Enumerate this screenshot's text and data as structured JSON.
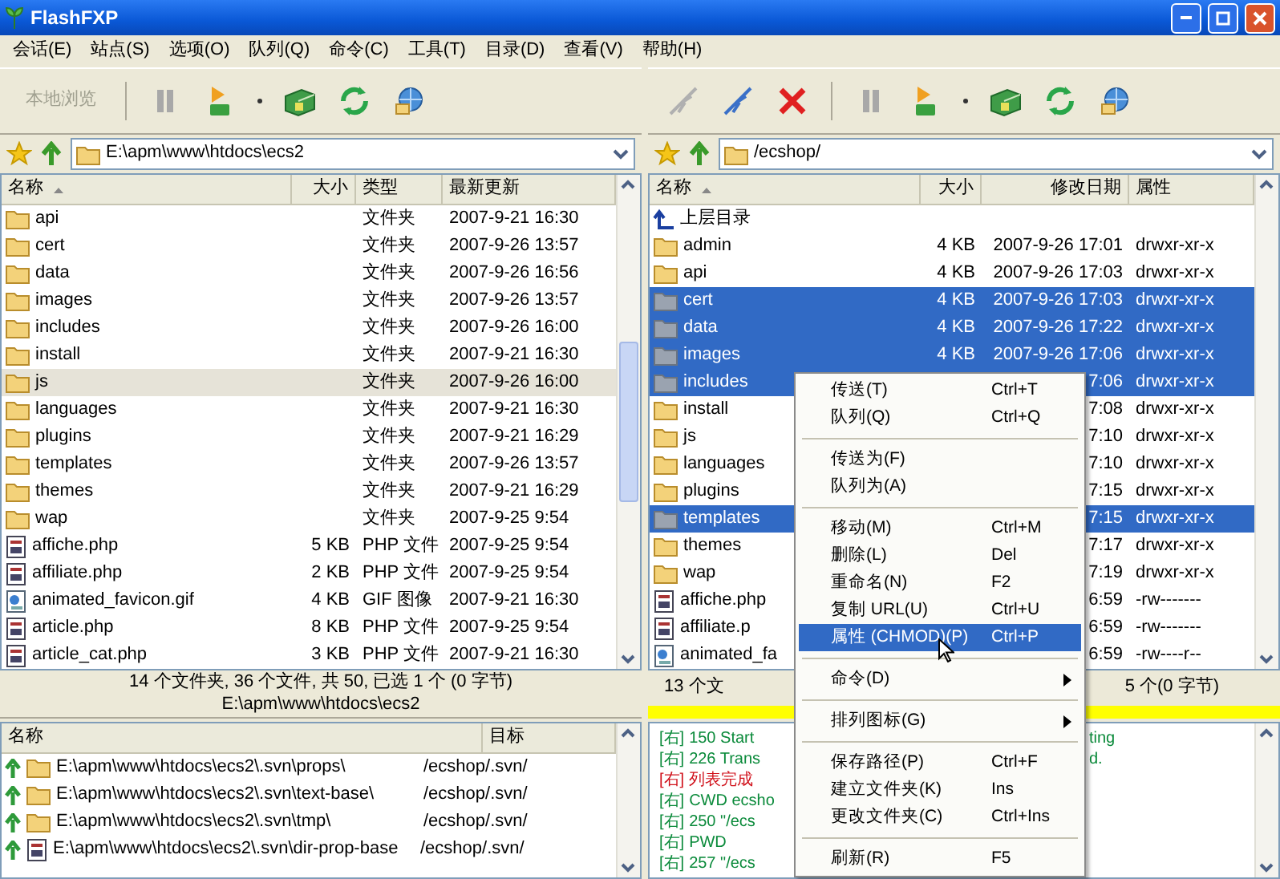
{
  "window": {
    "title": "FlashFXP"
  },
  "menu": [
    "会话(E)",
    "站点(S)",
    "选项(O)",
    "队列(Q)",
    "命令(C)",
    "工具(T)",
    "目录(D)",
    "查看(V)",
    "帮助(H)"
  ],
  "left_pane": {
    "toolbar_button": {
      "label": "本地浏览",
      "disabled": true
    },
    "path": "E:\\apm\\www\\htdocs\\ecs2",
    "columns": [
      "名称",
      "大小",
      "类型",
      "最新更新"
    ],
    "rows": [
      {
        "kind": "folder",
        "name": "api",
        "type": "文件夹",
        "date": "2007-9-21 16:30",
        "selected": false
      },
      {
        "kind": "folder",
        "name": "cert",
        "type": "文件夹",
        "date": "2007-9-26 13:57",
        "selected": false
      },
      {
        "kind": "folder",
        "name": "data",
        "type": "文件夹",
        "date": "2007-9-26 16:56",
        "selected": false
      },
      {
        "kind": "folder",
        "name": "images",
        "type": "文件夹",
        "date": "2007-9-26 13:57",
        "selected": false
      },
      {
        "kind": "folder",
        "name": "includes",
        "type": "文件夹",
        "date": "2007-9-26 16:00",
        "selected": false
      },
      {
        "kind": "folder",
        "name": "install",
        "type": "文件夹",
        "date": "2007-9-21 16:30",
        "selected": false
      },
      {
        "kind": "folder",
        "name": "js",
        "type": "文件夹",
        "date": "2007-9-26 16:00",
        "selected": true
      },
      {
        "kind": "folder",
        "name": "languages",
        "type": "文件夹",
        "date": "2007-9-21 16:30",
        "selected": false
      },
      {
        "kind": "folder",
        "name": "plugins",
        "type": "文件夹",
        "date": "2007-9-21 16:29",
        "selected": false
      },
      {
        "kind": "folder",
        "name": "templates",
        "type": "文件夹",
        "date": "2007-9-26 13:57",
        "selected": false
      },
      {
        "kind": "folder",
        "name": "themes",
        "type": "文件夹",
        "date": "2007-9-21 16:29",
        "selected": false
      },
      {
        "kind": "folder",
        "name": "wap",
        "type": "文件夹",
        "date": "2007-9-25 9:54",
        "selected": false
      },
      {
        "kind": "php",
        "name": "affiche.php",
        "size": "5 KB",
        "type": "PHP 文件",
        "date": "2007-9-25 9:54",
        "selected": false
      },
      {
        "kind": "php",
        "name": "affiliate.php",
        "size": "2 KB",
        "type": "PHP 文件",
        "date": "2007-9-25 9:54",
        "selected": false
      },
      {
        "kind": "gif",
        "name": "animated_favicon.gif",
        "size": "4 KB",
        "type": "GIF 图像",
        "date": "2007-9-21 16:30",
        "selected": false
      },
      {
        "kind": "php",
        "name": "article.php",
        "size": "8 KB",
        "type": "PHP 文件",
        "date": "2007-9-25 9:54",
        "selected": false
      },
      {
        "kind": "php",
        "name": "article_cat.php",
        "size": "3 KB",
        "type": "PHP 文件",
        "date": "2007-9-21 16:30",
        "selected": false
      }
    ],
    "status": [
      "14 个文件夹, 36 个文件, 共 50, 已选 1 个 (0 字节)",
      "E:\\apm\\www\\htdocs\\ecs2"
    ]
  },
  "right_pane": {
    "path": "/ecshop/",
    "columns": [
      "名称",
      "大小",
      "修改日期",
      "属性"
    ],
    "rows": [
      {
        "kind": "parent",
        "name": "上层目录",
        "selected": false
      },
      {
        "kind": "folder",
        "name": "admin",
        "size": "4 KB",
        "date": "2007-9-26 17:01",
        "attributes": "drwxr-xr-x",
        "selected": false
      },
      {
        "kind": "folder",
        "name": "api",
        "size": "4 KB",
        "date": "2007-9-26 17:03",
        "attributes": "drwxr-xr-x",
        "selected": false
      },
      {
        "kind": "folder",
        "name": "cert",
        "size": "4 KB",
        "date": "2007-9-26 17:03",
        "attributes": "drwxr-xr-x",
        "selected": true
      },
      {
        "kind": "folder",
        "name": "data",
        "size": "4 KB",
        "date": "2007-9-26 17:22",
        "attributes": "drwxr-xr-x",
        "selected": true
      },
      {
        "kind": "folder",
        "name": "images",
        "size": "4 KB",
        "date": "2007-9-26 17:06",
        "attributes": "drwxr-xr-x",
        "selected": true
      },
      {
        "kind": "folder",
        "name": "includes",
        "date": "7:06",
        "attributes": "drwxr-xr-x",
        "selected": true
      },
      {
        "kind": "folder",
        "name": "install",
        "date": "7:08",
        "attributes": "drwxr-xr-x",
        "selected": false
      },
      {
        "kind": "folder",
        "name": "js",
        "date": "7:10",
        "attributes": "drwxr-xr-x",
        "selected": false
      },
      {
        "kind": "folder",
        "name": "languages",
        "date": "7:10",
        "attributes": "drwxr-xr-x",
        "selected": false
      },
      {
        "kind": "folder",
        "name": "plugins",
        "date": "7:15",
        "attributes": "drwxr-xr-x",
        "selected": false
      },
      {
        "kind": "folder",
        "name": "templates",
        "date": "7:15",
        "attributes": "drwxr-xr-x",
        "selected": true
      },
      {
        "kind": "folder",
        "name": "themes",
        "date": "7:17",
        "attributes": "drwxr-xr-x",
        "selected": false
      },
      {
        "kind": "folder",
        "name": "wap",
        "date": "7:19",
        "attributes": "drwxr-xr-x",
        "selected": false
      },
      {
        "kind": "php",
        "name": "affiche.php",
        "date": "6:59",
        "attributes": "-rw-------",
        "selected": false
      },
      {
        "kind": "php",
        "name": "affiliate.p",
        "date": "6:59",
        "attributes": "-rw-------",
        "selected": false
      },
      {
        "kind": "gif",
        "name": "animated_fa",
        "date": "6:59",
        "attributes": "-rw----r--",
        "selected": false
      }
    ],
    "status": [
      "13 个文",
      "5 个(0 字节)"
    ]
  },
  "queue": {
    "columns": [
      "名称",
      "目标"
    ],
    "rows": [
      {
        "kind": "folder",
        "source": "E:\\apm\\www\\htdocs\\ecs2\\.svn\\props\\",
        "target": "/ecshop/.svn/"
      },
      {
        "kind": "folder",
        "source": "E:\\apm\\www\\htdocs\\ecs2\\.svn\\text-base\\",
        "target": "/ecshop/.svn/"
      },
      {
        "kind": "folder",
        "source": "E:\\apm\\www\\htdocs\\ecs2\\.svn\\tmp\\",
        "target": "/ecshop/.svn/"
      },
      {
        "kind": "file",
        "source": "E:\\apm\\www\\htdocs\\ecs2\\.svn\\dir-prop-base",
        "target": "/ecshop/.svn/"
      }
    ]
  },
  "log": [
    {
      "kind": "info",
      "tag": "[右]",
      "text": "150 Start",
      "tail": "ting"
    },
    {
      "kind": "info",
      "tag": "[右]",
      "text": "226 Trans",
      "tail": "d."
    },
    {
      "kind": "error",
      "tag": "[右]",
      "text": "列表完成"
    },
    {
      "kind": "info",
      "tag": "[右]",
      "text": "CWD ecsho"
    },
    {
      "kind": "info",
      "tag": "[右]",
      "text": "250 \"/ecs"
    },
    {
      "kind": "info",
      "tag": "[右]",
      "text": "PWD"
    },
    {
      "kind": "info",
      "tag": "[右]",
      "text": "257 \"/ecs"
    }
  ],
  "context_menu": [
    {
      "kind": "item",
      "label": "传送(T)",
      "shortcut": "Ctrl+T",
      "selected": false
    },
    {
      "kind": "item",
      "label": "队列(Q)",
      "shortcut": "Ctrl+Q",
      "selected": false
    },
    {
      "kind": "separator"
    },
    {
      "kind": "item",
      "label": "传送为(F)",
      "selected": false
    },
    {
      "kind": "item",
      "label": "队列为(A)",
      "selected": false
    },
    {
      "kind": "separator"
    },
    {
      "kind": "item",
      "label": "移动(M)",
      "shortcut": "Ctrl+M",
      "selected": false
    },
    {
      "kind": "item",
      "label": "删除(L)",
      "shortcut": "Del",
      "selected": false
    },
    {
      "kind": "item",
      "label": "重命名(N)",
      "shortcut": "F2",
      "selected": false
    },
    {
      "kind": "item",
      "label": "复制 URL(U)",
      "shortcut": "Ctrl+U",
      "selected": false
    },
    {
      "kind": "item",
      "label": "属性 (CHMOD)(P)",
      "shortcut": "Ctrl+P",
      "selected": true
    },
    {
      "kind": "separator"
    },
    {
      "kind": "submenu",
      "label": "命令(D)",
      "selected": false
    },
    {
      "kind": "separator"
    },
    {
      "kind": "submenu",
      "label": "排列图标(G)",
      "selected": false
    },
    {
      "kind": "separator"
    },
    {
      "kind": "item",
      "label": "保存路径(P)",
      "shortcut": "Ctrl+F",
      "selected": false
    },
    {
      "kind": "item",
      "label": "建立文件夹(K)",
      "shortcut": "Ins",
      "selected": false
    },
    {
      "kind": "item",
      "label": "更改文件夹(C)",
      "shortcut": "Ctrl+Ins",
      "selected": false
    },
    {
      "kind": "separator"
    },
    {
      "kind": "item",
      "label": "刷新(R)",
      "shortcut": "F5",
      "selected": false
    }
  ]
}
